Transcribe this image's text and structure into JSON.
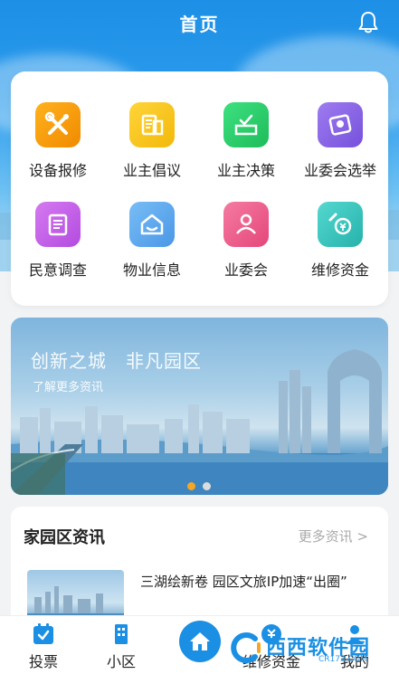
{
  "header": {
    "title": "首页",
    "bell_icon": "bell-icon"
  },
  "grid": {
    "items": [
      {
        "label": "设备报修",
        "icon": "wrench-screwdriver-icon",
        "color": "#f5a00b"
      },
      {
        "label": "业主倡议",
        "icon": "document-building-icon",
        "color": "#f5c40b"
      },
      {
        "label": "业主决策",
        "icon": "ballot-box-icon",
        "color": "#2ecf6c"
      },
      {
        "label": "业委会选举",
        "icon": "election-ballot-icon",
        "color": "#8a63e6"
      },
      {
        "label": "民意调查",
        "icon": "survey-clipboard-icon",
        "color": "#c85ce6"
      },
      {
        "label": "物业信息",
        "icon": "property-house-icon",
        "color": "#5aaaf0"
      },
      {
        "label": "业委会",
        "icon": "committee-people-icon",
        "color": "#f05a8c"
      },
      {
        "label": "维修资金",
        "icon": "repair-fund-icon",
        "color": "#38c6c0"
      }
    ]
  },
  "banner": {
    "slogan": "创新之城　非凡园区",
    "more": "了解更多资讯",
    "active_index": 0,
    "dot_active_color": "#f5a623",
    "dot_inactive_color": "#dcdcdc"
  },
  "news": {
    "heading": "家园区资讯",
    "more": "更多资讯 >",
    "items": [
      {
        "title": "三湖绘新卷 园区文旅IP加速“出圈”"
      }
    ]
  },
  "tabbar": {
    "accent": "#1a8fe3",
    "tabs": [
      {
        "label": "投票",
        "icon": "vote-box-icon"
      },
      {
        "label": "小区",
        "icon": "building-icon"
      },
      {
        "label": "",
        "icon": "home-icon"
      },
      {
        "label": "维修资金",
        "icon": "fund-icon"
      },
      {
        "label": "我的",
        "icon": "user-icon"
      }
    ]
  },
  "watermark": {
    "text": "西西软件园",
    "sub": "CR173.COM"
  }
}
